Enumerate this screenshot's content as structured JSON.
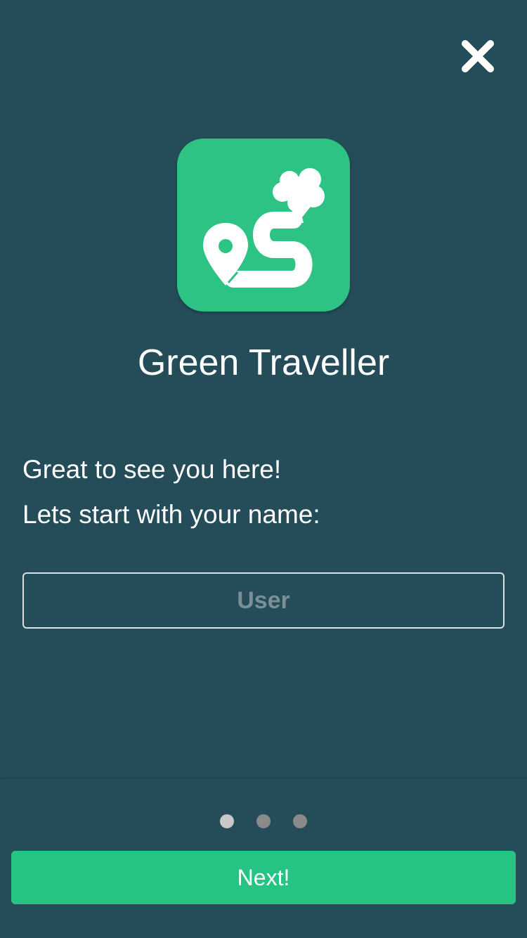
{
  "app": {
    "title": "Green Traveller",
    "icon": "green-traveller-logo",
    "accent_color": "#26c482",
    "background_color": "#244c59"
  },
  "header": {
    "close_icon": "close-icon"
  },
  "onboarding": {
    "greeting": "Great to see you here!",
    "prompt": "Lets start with your name:",
    "name_input": {
      "placeholder": "User",
      "value": ""
    }
  },
  "pagination": {
    "total_steps": 3,
    "current_step": 1
  },
  "footer": {
    "next_label": "Next!"
  }
}
